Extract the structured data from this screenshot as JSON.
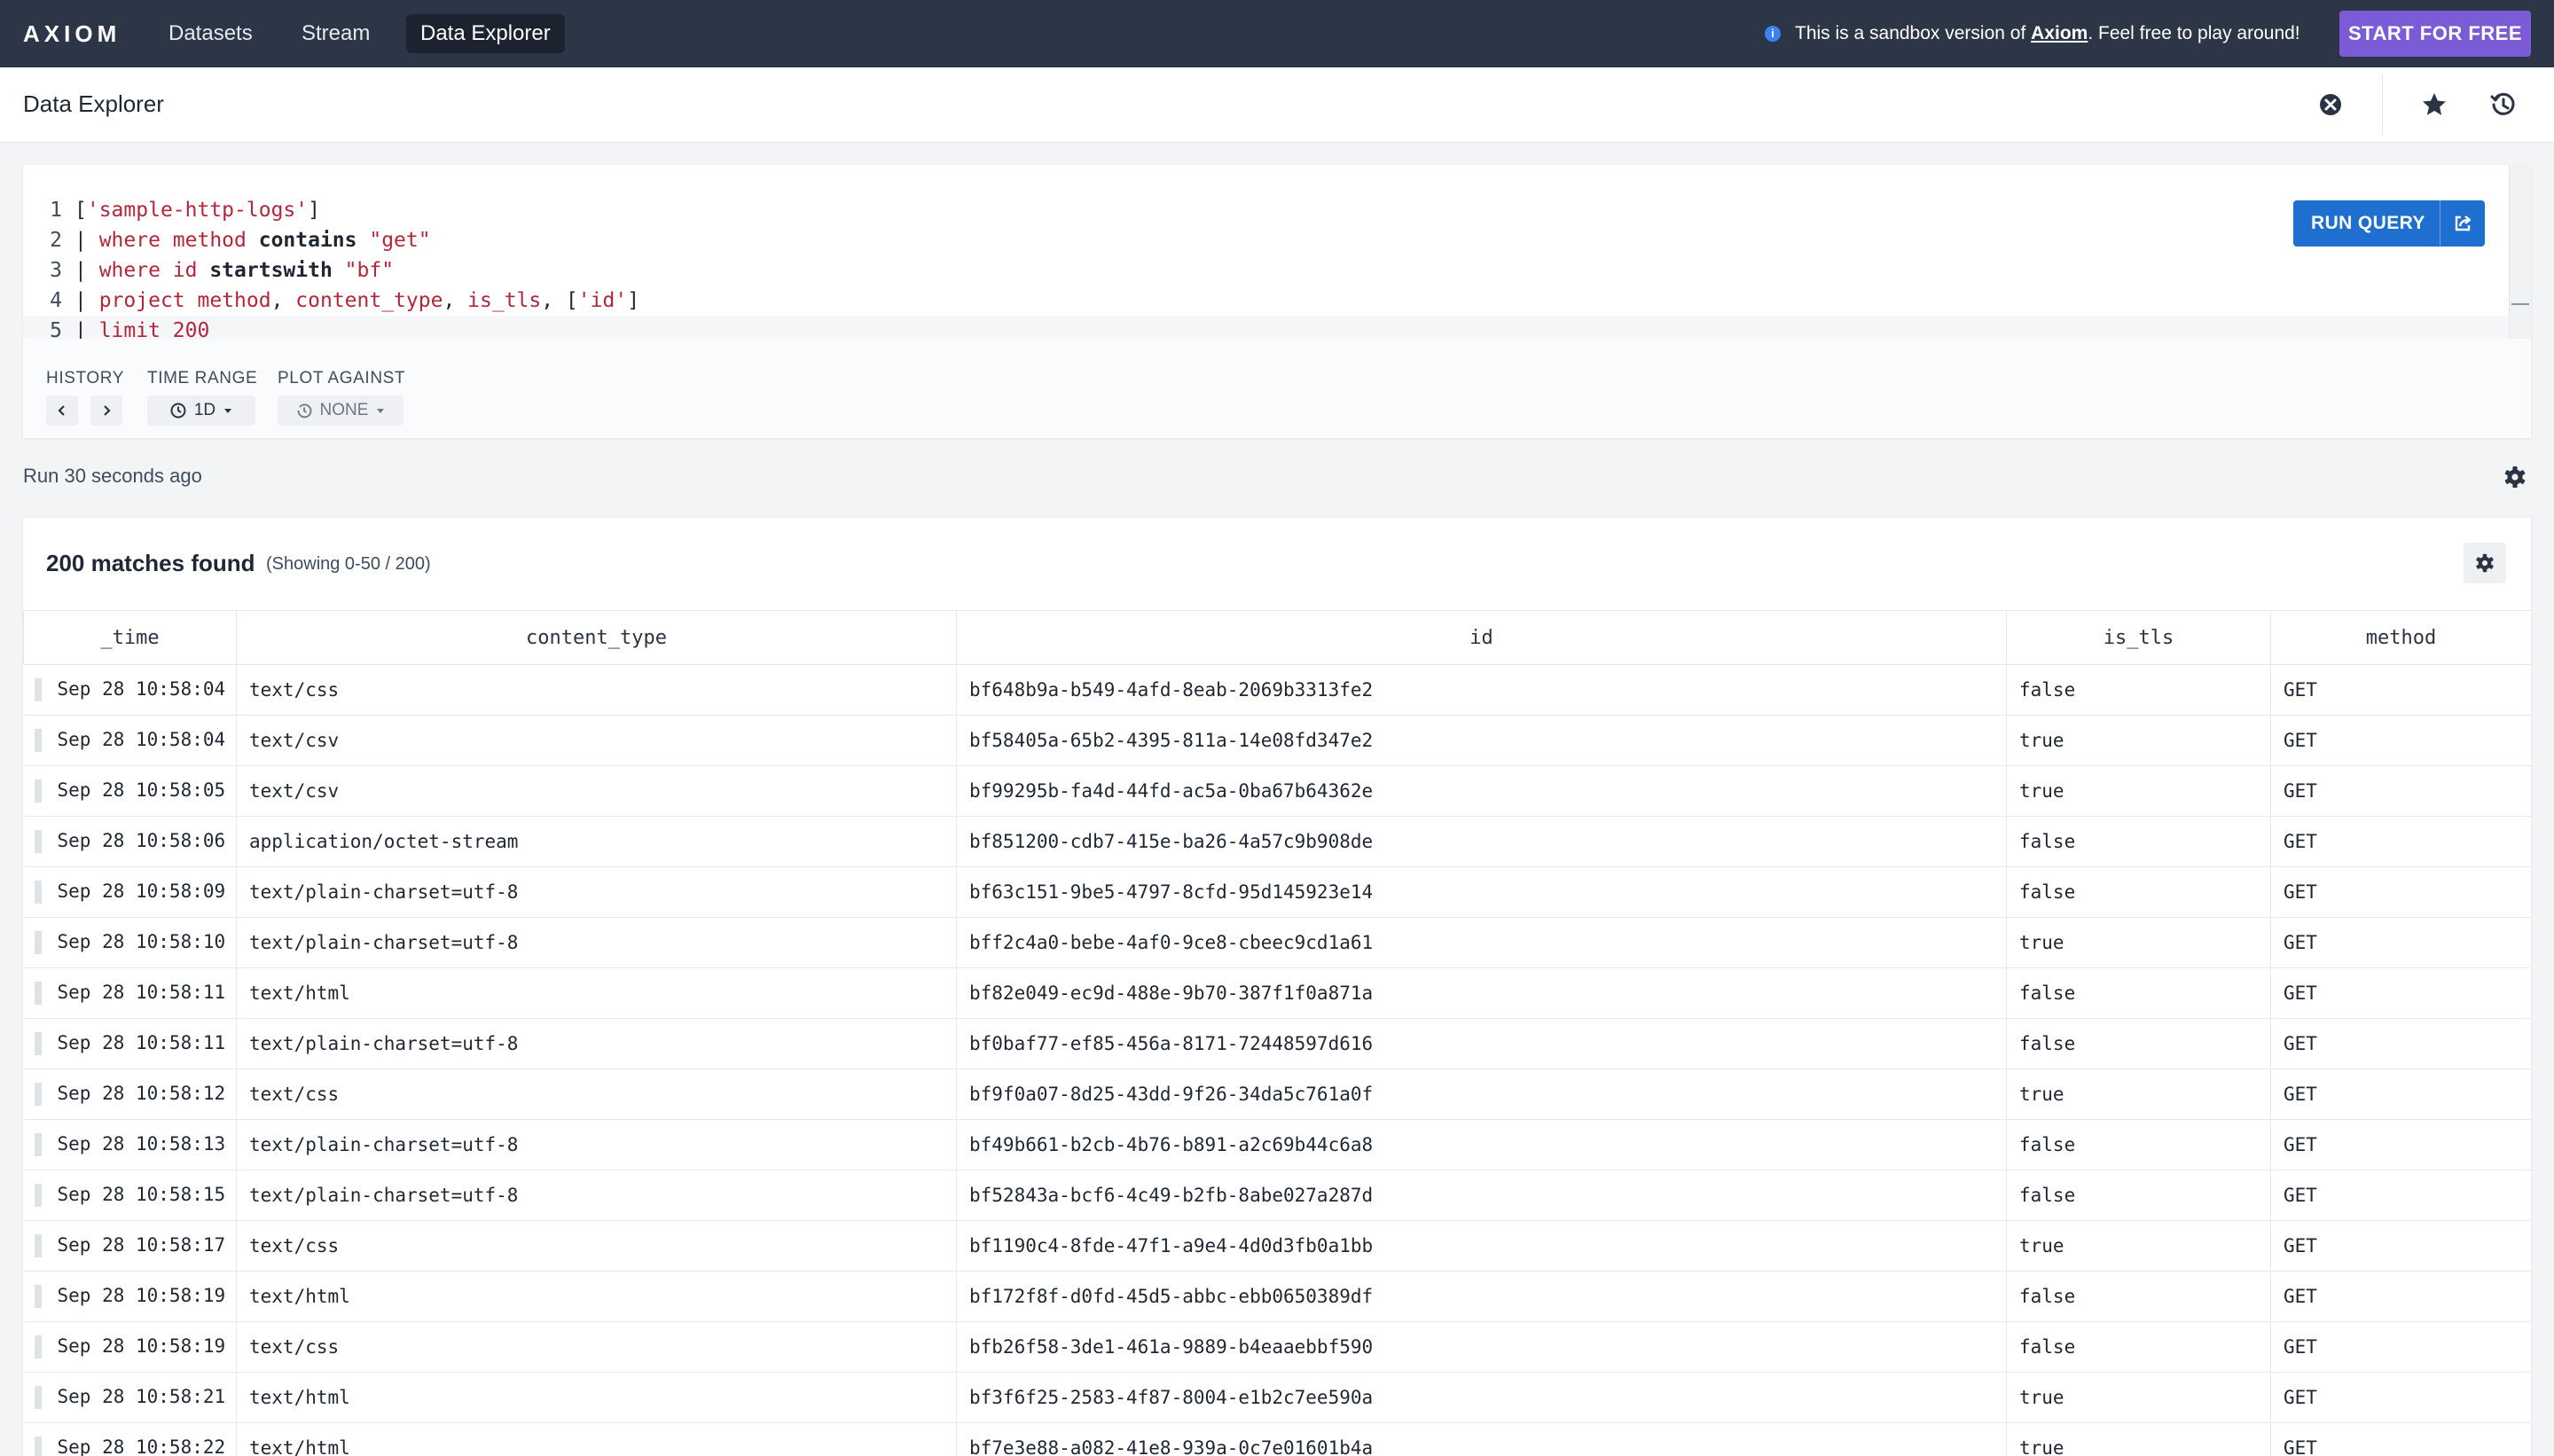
{
  "brand": {
    "logo": "AXIOM"
  },
  "nav": {
    "tabs": [
      {
        "label": "Datasets"
      },
      {
        "label": "Stream"
      },
      {
        "label": "Data Explorer"
      }
    ],
    "sandbox_prefix": "This is a sandbox version of ",
    "sandbox_link": "Axiom",
    "sandbox_suffix": ". Feel free to play around!",
    "cta": "START FOR FREE"
  },
  "page": {
    "title": "Data Explorer"
  },
  "query": {
    "lines": [
      {
        "n": "1",
        "parts": [
          {
            "t": "[",
            "c": "pl"
          },
          {
            "t": "'sample-http-logs'",
            "c": "str"
          },
          {
            "t": "]",
            "c": "pl"
          }
        ]
      },
      {
        "n": "2",
        "parts": [
          {
            "t": "| ",
            "c": "pl"
          },
          {
            "t": "where method ",
            "c": "kw"
          },
          {
            "t": "contains",
            "c": "op"
          },
          {
            "t": " ",
            "c": "pl"
          },
          {
            "t": "\"get\"",
            "c": "str"
          }
        ]
      },
      {
        "n": "3",
        "parts": [
          {
            "t": "| ",
            "c": "pl"
          },
          {
            "t": "where id ",
            "c": "kw"
          },
          {
            "t": "startswith",
            "c": "op"
          },
          {
            "t": " ",
            "c": "pl"
          },
          {
            "t": "\"bf\"",
            "c": "str"
          }
        ]
      },
      {
        "n": "4",
        "parts": [
          {
            "t": "| ",
            "c": "pl"
          },
          {
            "t": "project method",
            "c": "kw"
          },
          {
            "t": ", ",
            "c": "pl"
          },
          {
            "t": "content_type",
            "c": "kw"
          },
          {
            "t": ", ",
            "c": "pl"
          },
          {
            "t": "is_tls",
            "c": "kw"
          },
          {
            "t": ", [",
            "c": "pl"
          },
          {
            "t": "'id'",
            "c": "str"
          },
          {
            "t": "]",
            "c": "pl"
          }
        ]
      },
      {
        "n": "5",
        "parts": [
          {
            "t": "| ",
            "c": "pl"
          },
          {
            "t": "limit ",
            "c": "kw"
          },
          {
            "t": "200",
            "c": "num"
          }
        ]
      }
    ]
  },
  "controls": {
    "history_label": "HISTORY",
    "time_range_label": "TIME RANGE",
    "time_range_value": "1D",
    "plot_against_label": "PLOT AGAINST",
    "plot_against_value": "NONE",
    "run_button": "RUN QUERY"
  },
  "status": {
    "run_text": "Run 30 seconds ago"
  },
  "results": {
    "title": "200 matches found",
    "subtitle": "(Showing 0-50 / 200)",
    "columns": [
      "_time",
      "content_type",
      "id",
      "is_tls",
      "method"
    ],
    "rows": [
      [
        "Sep 28 10:58:04",
        "text/css",
        "bf648b9a-b549-4afd-8eab-2069b3313fe2",
        "false",
        "GET"
      ],
      [
        "Sep 28 10:58:04",
        "text/csv",
        "bf58405a-65b2-4395-811a-14e08fd347e2",
        "true",
        "GET"
      ],
      [
        "Sep 28 10:58:05",
        "text/csv",
        "bf99295b-fa4d-44fd-ac5a-0ba67b64362e",
        "true",
        "GET"
      ],
      [
        "Sep 28 10:58:06",
        "application/octet-stream",
        "bf851200-cdb7-415e-ba26-4a57c9b908de",
        "false",
        "GET"
      ],
      [
        "Sep 28 10:58:09",
        "text/plain-charset=utf-8",
        "bf63c151-9be5-4797-8cfd-95d145923e14",
        "false",
        "GET"
      ],
      [
        "Sep 28 10:58:10",
        "text/plain-charset=utf-8",
        "bff2c4a0-bebe-4af0-9ce8-cbeec9cd1a61",
        "true",
        "GET"
      ],
      [
        "Sep 28 10:58:11",
        "text/html",
        "bf82e049-ec9d-488e-9b70-387f1f0a871a",
        "false",
        "GET"
      ],
      [
        "Sep 28 10:58:11",
        "text/plain-charset=utf-8",
        "bf0baf77-ef85-456a-8171-72448597d616",
        "false",
        "GET"
      ],
      [
        "Sep 28 10:58:12",
        "text/css",
        "bf9f0a07-8d25-43dd-9f26-34da5c761a0f",
        "true",
        "GET"
      ],
      [
        "Sep 28 10:58:13",
        "text/plain-charset=utf-8",
        "bf49b661-b2cb-4b76-b891-a2c69b44c6a8",
        "false",
        "GET"
      ],
      [
        "Sep 28 10:58:15",
        "text/plain-charset=utf-8",
        "bf52843a-bcf6-4c49-b2fb-8abe027a287d",
        "false",
        "GET"
      ],
      [
        "Sep 28 10:58:17",
        "text/css",
        "bf1190c4-8fde-47f1-a9e4-4d0d3fb0a1bb",
        "true",
        "GET"
      ],
      [
        "Sep 28 10:58:19",
        "text/html",
        "bf172f8f-d0fd-45d5-abbc-ebb0650389df",
        "false",
        "GET"
      ],
      [
        "Sep 28 10:58:19",
        "text/css",
        "bfb26f58-3de1-461a-9889-b4eaaebbf590",
        "false",
        "GET"
      ],
      [
        "Sep 28 10:58:21",
        "text/html",
        "bf3f6f25-2583-4f87-8004-e1b2c7ee590a",
        "true",
        "GET"
      ],
      [
        "Sep 28 10:58:22",
        "text/html",
        "bf7e3e88-a082-41e8-939a-0c7e01601b4a",
        "true",
        "GET"
      ]
    ]
  },
  "colors": {
    "topnav_bg": "#2c3646",
    "cta_bg": "#7c5cd6",
    "run_bg": "#1e6fd0",
    "code_keyword": "#b3263c"
  },
  "icons": [
    "info-icon",
    "clear-icon",
    "star-icon",
    "history-icon",
    "chevron-left-icon",
    "chevron-right-icon",
    "clock-icon",
    "caret-down-icon",
    "share-icon",
    "gear-icon"
  ]
}
